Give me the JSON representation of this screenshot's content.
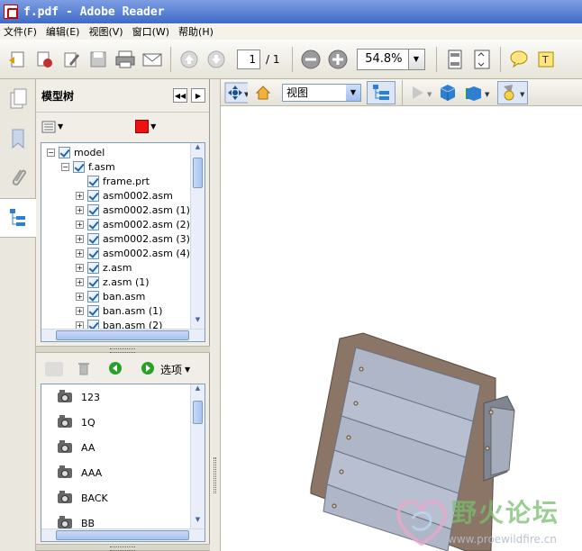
{
  "window": {
    "title": "f.pdf - Adobe Reader"
  },
  "menu": [
    "文件(F)",
    "编辑(E)",
    "视图(V)",
    "窗口(W)",
    "帮助(H)"
  ],
  "toolbar": {
    "page_current": "1",
    "page_total": "/ 1",
    "zoom": "54.8%"
  },
  "panel": {
    "title": "模型树",
    "color_swatch": "#ee1111",
    "tree": [
      {
        "label": "model",
        "level": 0,
        "expander": "−"
      },
      {
        "label": "f.asm",
        "level": 1,
        "expander": "−"
      },
      {
        "label": "frame.prt",
        "level": 2,
        "expander": ""
      },
      {
        "label": "asm0002.asm",
        "level": 2,
        "expander": "+"
      },
      {
        "label": "asm0002.asm (1)",
        "level": 2,
        "expander": "+"
      },
      {
        "label": "asm0002.asm (2)",
        "level": 2,
        "expander": "+"
      },
      {
        "label": "asm0002.asm (3)",
        "level": 2,
        "expander": "+"
      },
      {
        "label": "asm0002.asm (4)",
        "level": 2,
        "expander": "+"
      },
      {
        "label": "z.asm",
        "level": 2,
        "expander": "+"
      },
      {
        "label": "z.asm (1)",
        "level": 2,
        "expander": "+"
      },
      {
        "label": "ban.asm",
        "level": 2,
        "expander": "+"
      },
      {
        "label": "ban.asm (1)",
        "level": 2,
        "expander": "+"
      },
      {
        "label": "ban.asm (2)",
        "level": 2,
        "expander": "+"
      }
    ],
    "options_label": "选项",
    "views": [
      "123",
      "1Q",
      "AA",
      "AAA",
      "BACK",
      "BB"
    ]
  },
  "doc_toolbar": {
    "view_select": "视图"
  },
  "watermark": {
    "cn": "野火论坛",
    "url": "www.proewildfire.cn"
  },
  "colors": {
    "accent": "#3f6bc7",
    "model_plate": "#b4bdd0",
    "model_frame": "#8a7566"
  }
}
